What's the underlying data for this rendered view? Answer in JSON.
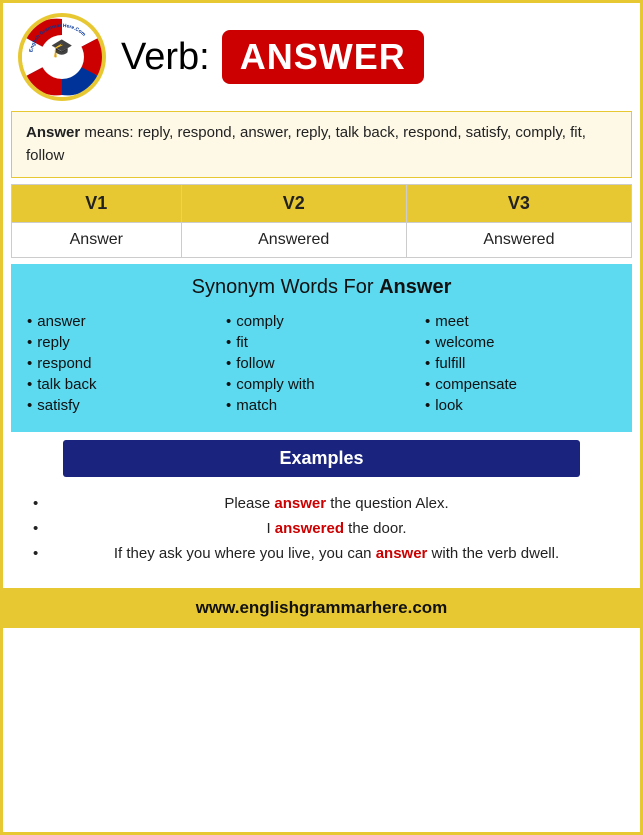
{
  "header": {
    "verb_label": "Verb:",
    "word": "ANSWER",
    "logo_line1": "English Grammar Here.Com"
  },
  "definition": {
    "word_bold": "Answer",
    "text": " means: reply, respond, answer, reply, talk back, respond, satisfy, comply, fit, follow"
  },
  "verb_table": {
    "headers": [
      "V1",
      "V2",
      "V3"
    ],
    "row": [
      "Answer",
      "Answered",
      "Answered"
    ]
  },
  "synonym": {
    "title_plain": "Synonym Words For ",
    "title_bold": "Answer",
    "col1": [
      "answer",
      "reply",
      "respond",
      "talk back",
      "satisfy"
    ],
    "col2": [
      "comply",
      "fit",
      "follow",
      "comply with",
      "match"
    ],
    "col3": [
      "meet",
      "welcome",
      "fulfill",
      "compensate",
      "look"
    ]
  },
  "examples": {
    "section_label": "Examples",
    "items": [
      {
        "before": "Please ",
        "highlight": "answer",
        "after": " the question Alex."
      },
      {
        "before": "I ",
        "highlight": "answered",
        "after": " the door."
      },
      {
        "before": "If they ask you where you live, you can ",
        "highlight": "answer",
        "after": " with the verb dwell."
      }
    ]
  },
  "footer": {
    "url": "www.englishgrammarhere.com"
  }
}
